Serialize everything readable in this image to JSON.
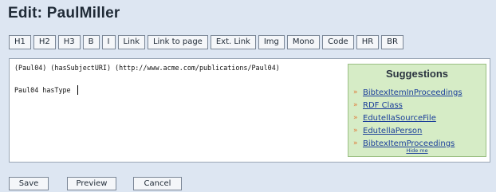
{
  "page": {
    "title": "Edit: PaulMiller"
  },
  "toolbar": {
    "buttons": [
      {
        "label": "H1"
      },
      {
        "label": "H2"
      },
      {
        "label": "H3"
      },
      {
        "label": "B"
      },
      {
        "label": "I"
      },
      {
        "label": "Link"
      },
      {
        "label": "Link to page"
      },
      {
        "label": "Ext. Link"
      },
      {
        "label": "Img"
      },
      {
        "label": "Mono"
      },
      {
        "label": "Code"
      },
      {
        "label": "HR"
      },
      {
        "label": "BR"
      }
    ]
  },
  "editor": {
    "line1": "(Paul04) (hasSubjectURI) (http://www.acme.com/publications/Paul04)",
    "line2": "Paul04 hasType "
  },
  "suggestions": {
    "title": "Suggestions",
    "items": [
      {
        "label": "BibtexItemInProceedings"
      },
      {
        "label": "RDF Class"
      },
      {
        "label": "EdutellaSourceFile"
      },
      {
        "label": "EdutellaPerson"
      },
      {
        "label": "BibtexItemProceedings"
      }
    ],
    "hide_label": "Hide me"
  },
  "actions": {
    "save_label": "Save",
    "preview_label": "Preview",
    "cancel_label": "Cancel"
  },
  "colors": {
    "page_bg": "#dde6f2",
    "suggest_bg": "#d6ecc6",
    "link": "#1a3e9a",
    "bullet": "#e07b39"
  }
}
